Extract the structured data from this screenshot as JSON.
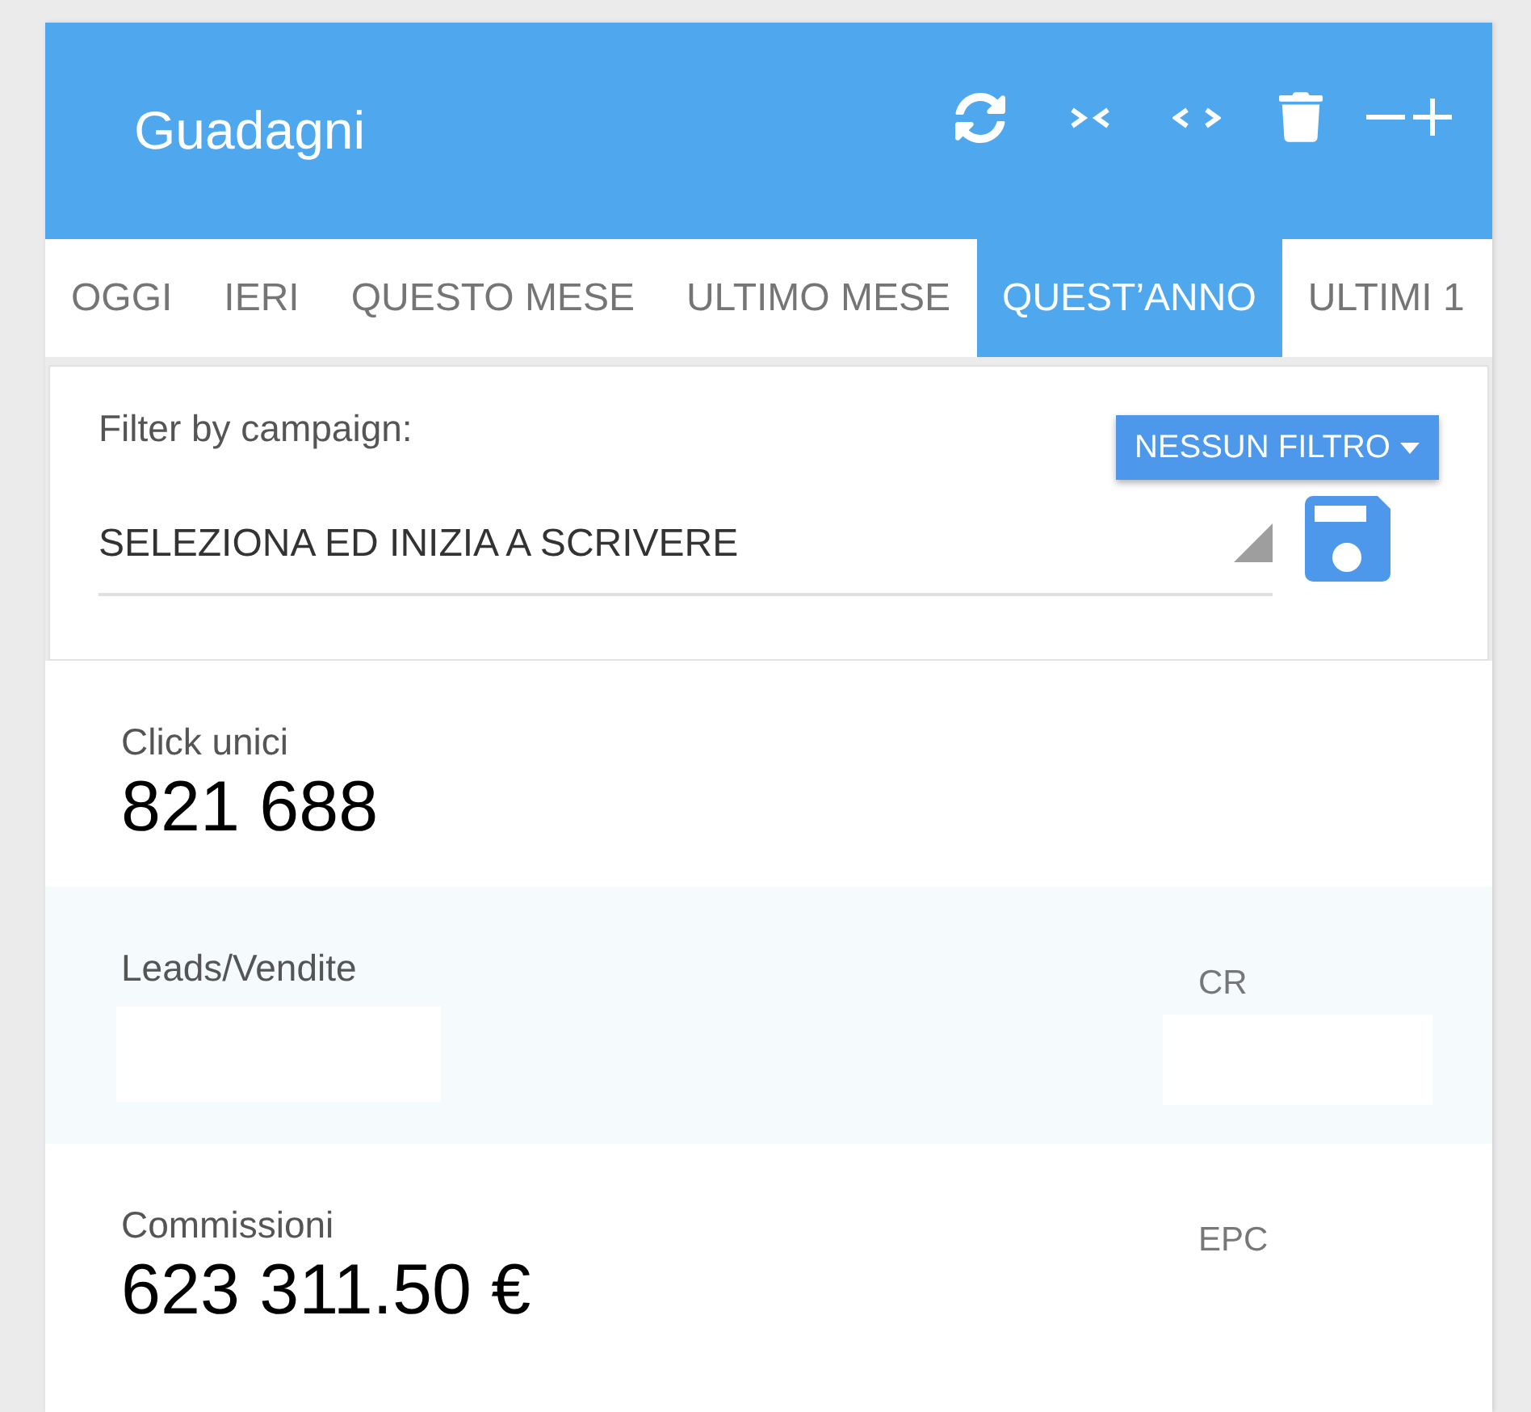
{
  "header": {
    "title": "Guadagni"
  },
  "tabs": [
    {
      "label": "OGGI",
      "selected": false
    },
    {
      "label": "IERI",
      "selected": false
    },
    {
      "label": "QUESTO MESE",
      "selected": false
    },
    {
      "label": "ULTIMO MESE",
      "selected": false
    },
    {
      "label": "QUEST’ANNO",
      "selected": true
    },
    {
      "label": "ULTIMI 1",
      "selected": false
    }
  ],
  "filter": {
    "label": "Filter by campaign:",
    "button": "NESSUN FILTRO",
    "campaign_select": {
      "placeholder": "SELEZIONA ED INIZIA A SCRIVERE"
    }
  },
  "stats": [
    {
      "items": [
        {
          "kind": "figure",
          "label": "Click unici",
          "value": "821 688"
        }
      ]
    },
    {
      "items": [
        {
          "kind": "empty",
          "label": "Leads/Vendite"
        },
        {
          "kind": "empty",
          "label": "CR"
        }
      ]
    },
    {
      "items": [
        {
          "kind": "figure",
          "label": "Commissioni",
          "value": "623 311.50 €"
        },
        {
          "kind": "label",
          "label": "EPC"
        }
      ]
    }
  ]
}
